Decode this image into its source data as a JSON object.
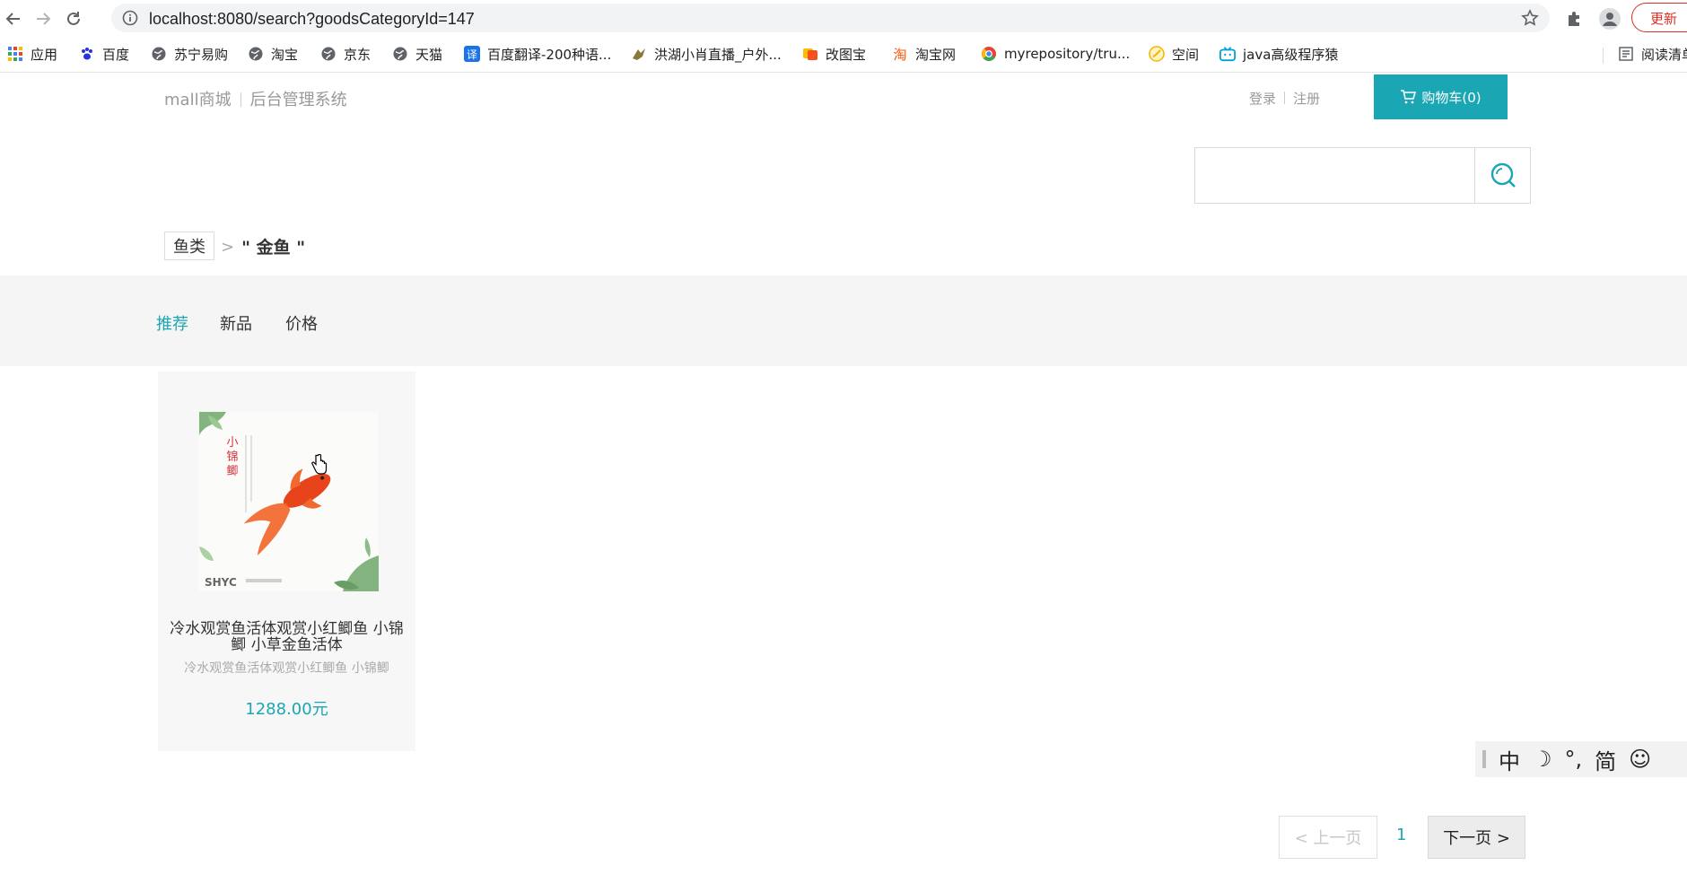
{
  "browser": {
    "url": "localhost:8080/search?goodsCategoryId=147",
    "update_label": "更新",
    "icons": {
      "back": "arrow-left-icon",
      "forward": "arrow-right-icon",
      "reload": "reload-icon",
      "info": "info-icon",
      "star": "star-icon",
      "extensions": "puzzle-icon",
      "profile": "profile-icon"
    }
  },
  "bookmarks": {
    "items": [
      {
        "label": "应用",
        "icon": "apps-grid-icon",
        "color": "#4285f4"
      },
      {
        "label": "百度",
        "icon": "baidu-paw-icon",
        "color": "#2932e1"
      },
      {
        "label": "苏宁易购",
        "icon": "globe-icon",
        "color": "#5f6368"
      },
      {
        "label": "淘宝",
        "icon": "globe-icon",
        "color": "#5f6368"
      },
      {
        "label": "京东",
        "icon": "globe-icon",
        "color": "#5f6368"
      },
      {
        "label": "天猫",
        "icon": "globe-icon",
        "color": "#5f6368"
      },
      {
        "label": "百度翻译-200种语...",
        "icon": "translate-icon",
        "color": "#1a73e8"
      },
      {
        "label": "洪湖小肖直播_户外...",
        "icon": "bird-icon",
        "color": "#8a7a3a"
      },
      {
        "label": "改图宝",
        "icon": "image-edit-icon",
        "color": "#f4511e"
      },
      {
        "label": "淘宝网",
        "icon": "taobao-icon",
        "color": "#ff5000"
      },
      {
        "label": "myrepository/tru...",
        "icon": "chrome-icon",
        "color": "#34a853"
      },
      {
        "label": "空间",
        "icon": "qzone-icon",
        "color": "#f4b400"
      },
      {
        "label": "java高级程序猿",
        "icon": "bilibili-icon",
        "color": "#00a1d6"
      }
    ],
    "reading_list_label": "阅读清单"
  },
  "site": {
    "brand": "mall商城",
    "admin": "后台管理系统",
    "login": "登录",
    "register": "注册",
    "cart_label": "购物车(0)",
    "accent": "#1ba6b4"
  },
  "search": {
    "value": "",
    "placeholder": ""
  },
  "breadcrumb": {
    "category": "鱼类",
    "arrow": ">",
    "keyword": "\" 金鱼 \""
  },
  "sort": {
    "recommend": "推荐",
    "new": "新品",
    "price": "价格",
    "active": "推荐"
  },
  "products": [
    {
      "title": "冷水观赏鱼活体观赏小红鲫鱼 小锦鲫 小草金鱼活体",
      "subtitle": "冷水观赏鱼活体观赏小红鲫鱼 小锦鲫",
      "price": "1288.00元",
      "image_caption": "小锦鲫",
      "image_brand": "SHYC"
    }
  ],
  "ime": {
    "items": [
      "中",
      "☽",
      "°,",
      "简",
      "☺"
    ]
  },
  "pagination": {
    "prev": "< 上一页",
    "current": "1",
    "next": "下一页 >"
  }
}
